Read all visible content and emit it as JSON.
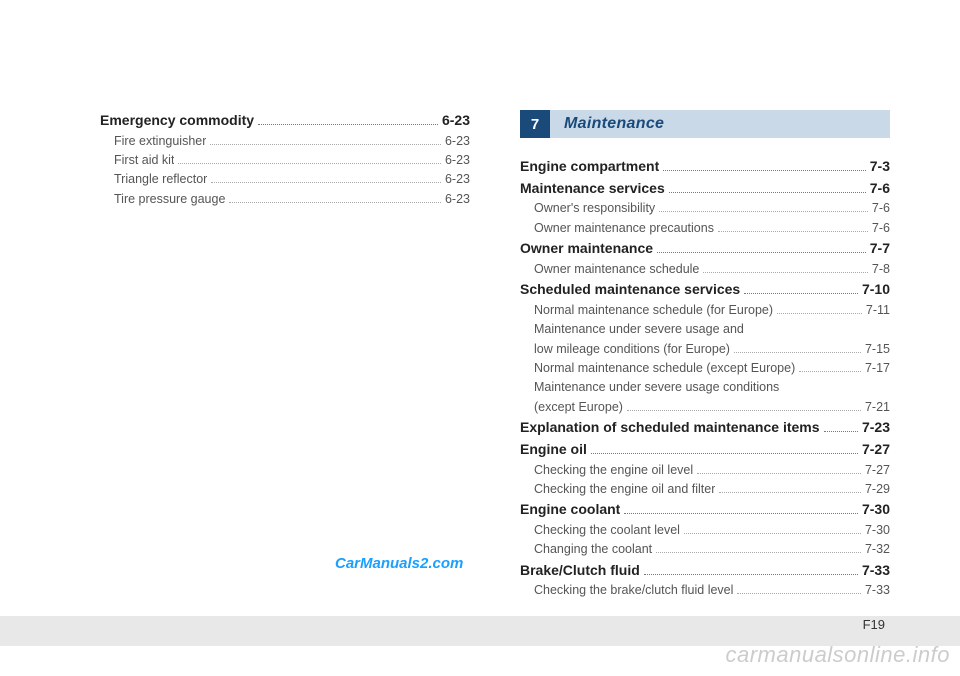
{
  "left": {
    "heading": {
      "label": "Emergency commodity",
      "page": "6-23"
    },
    "items": [
      {
        "label": "Fire extinguisher",
        "page": "6-23"
      },
      {
        "label": "First aid kit",
        "page": "6-23"
      },
      {
        "label": "Triangle reflector",
        "page": "6-23"
      },
      {
        "label": "Tire pressure gauge",
        "page": "6-23"
      }
    ]
  },
  "chapter": {
    "num": "7",
    "title": "Maintenance"
  },
  "right": [
    {
      "type": "bold",
      "label": "Engine compartment",
      "page": "7-3"
    },
    {
      "type": "bold",
      "label": "Maintenance services",
      "page": "7-6"
    },
    {
      "type": "sub",
      "label": "Owner's responsibility",
      "page": "7-6"
    },
    {
      "type": "sub",
      "label": "Owner maintenance precautions",
      "page": "7-6"
    },
    {
      "type": "bold",
      "label": "Owner maintenance",
      "page": "7-7"
    },
    {
      "type": "sub",
      "label": "Owner maintenance schedule",
      "page": "7-8"
    },
    {
      "type": "bold",
      "label": "Scheduled maintenance services",
      "page": "7-10"
    },
    {
      "type": "sub",
      "label": "Normal maintenance schedule (for Europe)",
      "page": "7-11"
    },
    {
      "type": "subtext",
      "label": "Maintenance under severe usage and"
    },
    {
      "type": "sub",
      "label": "low mileage conditions (for Europe)",
      "page": "7-15"
    },
    {
      "type": "sub",
      "label": "Normal maintenance schedule (except Europe)",
      "page": "7-17"
    },
    {
      "type": "subtext",
      "label": "Maintenance under severe usage conditions"
    },
    {
      "type": "sub",
      "label": "(except Europe)",
      "page": "7-21"
    },
    {
      "type": "bold",
      "label": "Explanation of scheduled maintenance items",
      "page": "7-23"
    },
    {
      "type": "bold",
      "label": "Engine oil",
      "page": "7-27"
    },
    {
      "type": "sub",
      "label": "Checking the engine oil level",
      "page": "7-27"
    },
    {
      "type": "sub",
      "label": "Checking the engine oil and filter",
      "page": "7-29"
    },
    {
      "type": "bold",
      "label": "Engine coolant",
      "page": "7-30"
    },
    {
      "type": "sub",
      "label": "Checking the coolant level",
      "page": "7-30"
    },
    {
      "type": "sub",
      "label": "Changing the coolant",
      "page": "7-32"
    },
    {
      "type": "bold",
      "label": "Brake/Clutch fluid",
      "page": "7-33"
    },
    {
      "type": "sub",
      "label": "Checking the brake/clutch fluid level",
      "page": "7-33"
    }
  ],
  "watermark1": "CarManuals2.com",
  "watermark2": "carmanualsonline.info",
  "pagenum": "F19"
}
